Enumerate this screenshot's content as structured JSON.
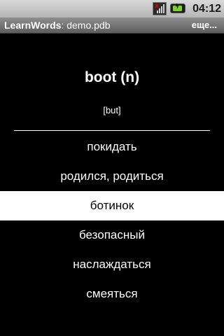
{
  "status_bar": {
    "time": "04:12",
    "icons": [
      "signal-icon",
      "battery-charging-icon"
    ]
  },
  "title_bar": {
    "app_name": "LearnWords",
    "separator": ": ",
    "file": "demo.pdb",
    "more_label": "еще..."
  },
  "word": {
    "text": "boot (n)",
    "transcription": "[but]"
  },
  "options": [
    {
      "label": "покидать",
      "selected": false
    },
    {
      "label": "родился, родиться",
      "selected": false
    },
    {
      "label": "ботинок",
      "selected": true
    },
    {
      "label": "безопасный",
      "selected": false
    },
    {
      "label": "наслаждаться",
      "selected": false
    },
    {
      "label": "смеяться",
      "selected": false
    }
  ],
  "colors": {
    "background": "#000000",
    "text": "#ffffff",
    "selected_bg": "#ffffff",
    "selected_text": "#000000",
    "battery": "#7bd32a"
  }
}
